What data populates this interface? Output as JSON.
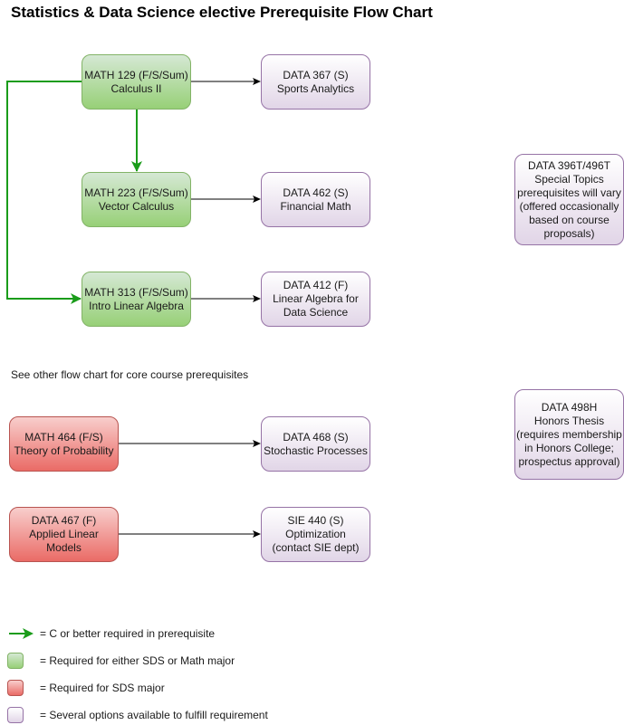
{
  "title": "Statistics & Data Science elective Prerequisite Flow Chart",
  "note": "See other flow chart for core course prerequisites",
  "colors": {
    "green_fill": "#d5e8d4",
    "green_stroke": "#82b366",
    "red_fill": "#f8cecc",
    "red_stroke": "#b85450",
    "purple_fill": "#e1d5e7",
    "purple_stroke": "#9673a6",
    "green_arrow": "#1a9c1a",
    "black_arrow": "#000000"
  },
  "nodes": {
    "math129": {
      "line1": "MATH 129 (F/S/Sum)",
      "line2": "Calculus II"
    },
    "math223": {
      "line1": "MATH 223 (F/S/Sum)",
      "line2": "Vector Calculus"
    },
    "math313": {
      "line1": "MATH 313 (F/S/Sum)",
      "line2": "Intro Linear Algebra"
    },
    "data367": {
      "line1": "DATA 367 (S)",
      "line2": "Sports Analytics"
    },
    "data462": {
      "line1": "DATA 462 (S)",
      "line2": "Financial Math"
    },
    "data412": {
      "line1": "DATA 412 (F)",
      "line2": "Linear Algebra for",
      "line3": "Data Science"
    },
    "data396": {
      "line1": "DATA 396T/496T",
      "line2": "Special Topics",
      "line3": "prerequisites will vary",
      "line4": "(offered occasionally",
      "line5": "based on course",
      "line6": "proposals)"
    },
    "math464": {
      "line1": "MATH 464 (F/S)",
      "line2": "Theory of Probability"
    },
    "data468": {
      "line1": "DATA 468 (S)",
      "line2": "Stochastic Processes"
    },
    "data498": {
      "line1": "DATA 498H",
      "line2": "Honors Thesis",
      "line3": "(requires membership",
      "line4": "in Honors College;",
      "line5": "prospectus approval)"
    },
    "data467": {
      "line1": "DATA 467 (F)",
      "line2": "Applied Linear",
      "line3": "Models"
    },
    "sie440": {
      "line1": "SIE 440 (S)",
      "line2": "Optimization",
      "line3": "(contact SIE dept)"
    }
  },
  "edges": [
    {
      "from": "MATH 129",
      "to": "DATA 367",
      "type": "prerequisite"
    },
    {
      "from": "MATH 129",
      "to": "MATH 223",
      "type": "C or better"
    },
    {
      "from": "MATH 129",
      "to": "MATH 313",
      "type": "C or better"
    },
    {
      "from": "MATH 223",
      "to": "DATA 462",
      "type": "prerequisite"
    },
    {
      "from": "MATH 313",
      "to": "DATA 412",
      "type": "prerequisite"
    },
    {
      "from": "MATH 464",
      "to": "DATA 468",
      "type": "prerequisite"
    },
    {
      "from": "DATA 467",
      "to": "SIE 440",
      "type": "prerequisite"
    }
  ],
  "legend": {
    "arrow": "= C or better required in prerequisite",
    "green": "= Required for either SDS or Math major",
    "red": "= Required for SDS major",
    "purple": "= Several options available to fulfill requirement"
  }
}
